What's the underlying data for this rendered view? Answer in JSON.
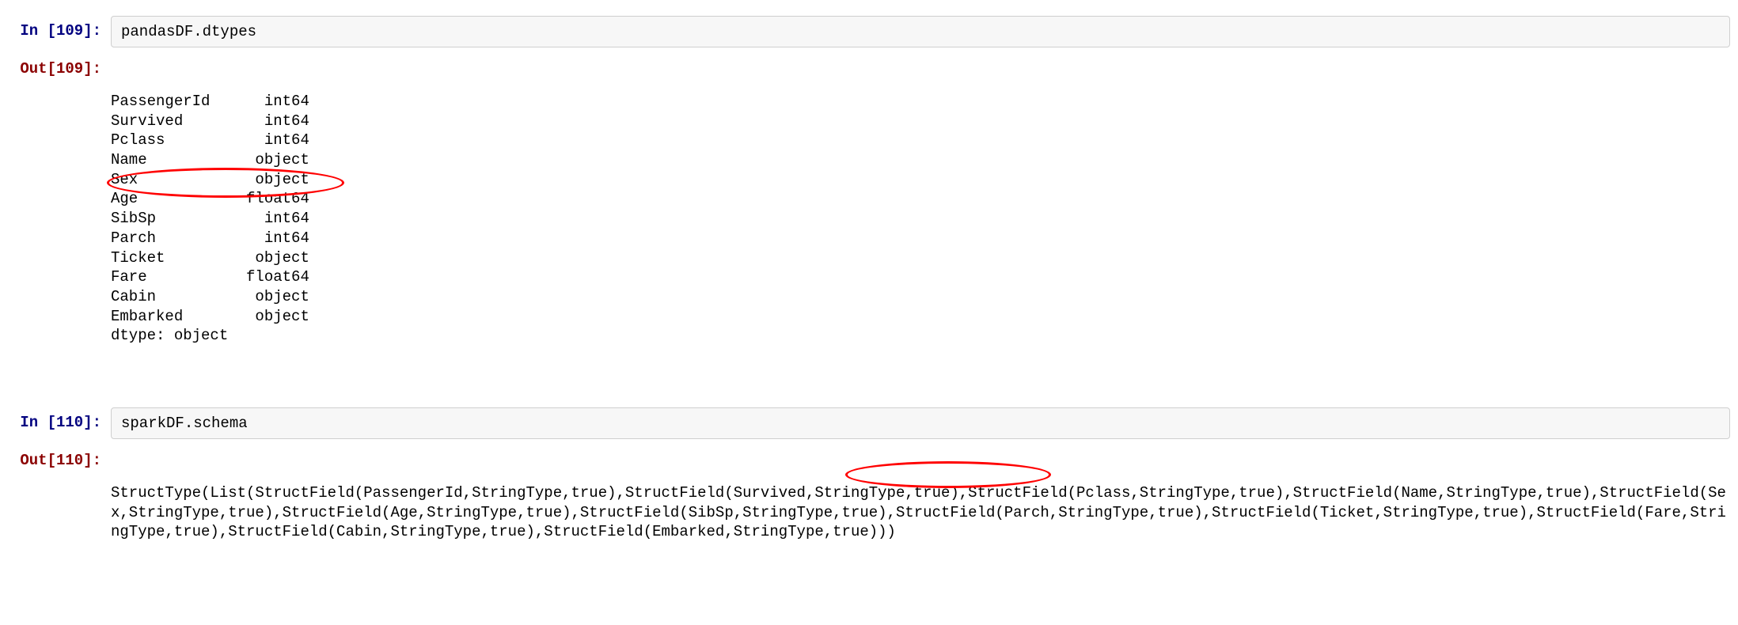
{
  "cells": {
    "in109": {
      "prompt": "In [109]:",
      "code": "pandasDF.dtypes"
    },
    "out109": {
      "prompt": "Out[109]:",
      "rows": [
        {
          "name": "PassengerId",
          "dtype": "int64"
        },
        {
          "name": "Survived",
          "dtype": "int64"
        },
        {
          "name": "Pclass",
          "dtype": "int64"
        },
        {
          "name": "Name",
          "dtype": "object"
        },
        {
          "name": "Sex",
          "dtype": "object"
        },
        {
          "name": "Age",
          "dtype": "float64"
        },
        {
          "name": "SibSp",
          "dtype": "int64"
        },
        {
          "name": "Parch",
          "dtype": "int64"
        },
        {
          "name": "Ticket",
          "dtype": "object"
        },
        {
          "name": "Fare",
          "dtype": "float64"
        },
        {
          "name": "Cabin",
          "dtype": "object"
        },
        {
          "name": "Embarked",
          "dtype": "object"
        }
      ],
      "footer": "dtype: object"
    },
    "in110": {
      "prompt": "In [110]:",
      "code": "sparkDF.schema"
    },
    "out110": {
      "prompt": "Out[110]:",
      "text": "StructType(List(StructField(PassengerId,StringType,true),StructField(Survived,StringType,true),StructField(Pclass,StringType,true),StructField(Name,StringType,true),StructField(Sex,StringType,true),StructField(Age,StringType,true),StructField(SibSp,StringType,true),StructField(Parch,StringType,true),StructField(Ticket,StringType,true),StructField(Fare,StringType,true),StructField(Cabin,StringType,true),StructField(Embarked,StringType,true)))"
    }
  }
}
